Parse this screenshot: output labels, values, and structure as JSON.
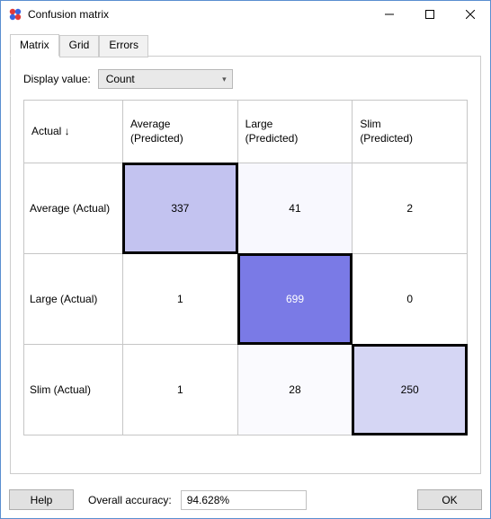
{
  "window": {
    "title": "Confusion matrix",
    "min": "minimize",
    "max": "maximize",
    "close": "close"
  },
  "tabs": {
    "matrix": "Matrix",
    "grid": "Grid",
    "errors": "Errors"
  },
  "display": {
    "label": "Display value:",
    "selected": "Count"
  },
  "headers": {
    "corner": "Actual ↓",
    "cols": {
      "0": "Average\n(Predicted)",
      "1": "Large\n(Predicted)",
      "2": "Slim\n(Predicted)"
    },
    "rows": {
      "0": "Average (Actual)",
      "1": "Large (Actual)",
      "2": "Slim (Actual)"
    }
  },
  "cells": {
    "r0c0": "337",
    "r0c1": "41",
    "r0c2": "2",
    "r1c0": "1",
    "r1c1": "699",
    "r1c2": "0",
    "r2c0": "1",
    "r2c1": "28",
    "r2c2": "250"
  },
  "footer": {
    "help": "Help",
    "accuracy_label": "Overall accuracy:",
    "accuracy_value": "94.628%",
    "ok": "OK"
  },
  "chart_data": {
    "type": "heatmap",
    "title": "Confusion matrix",
    "display_value": "Count",
    "x_categories": [
      "Average (Predicted)",
      "Large (Predicted)",
      "Slim (Predicted)"
    ],
    "y_categories": [
      "Average (Actual)",
      "Large (Actual)",
      "Slim (Actual)"
    ],
    "values": [
      [
        337,
        41,
        2
      ],
      [
        1,
        699,
        0
      ],
      [
        1,
        28,
        250
      ]
    ],
    "overall_accuracy": 94.628
  }
}
